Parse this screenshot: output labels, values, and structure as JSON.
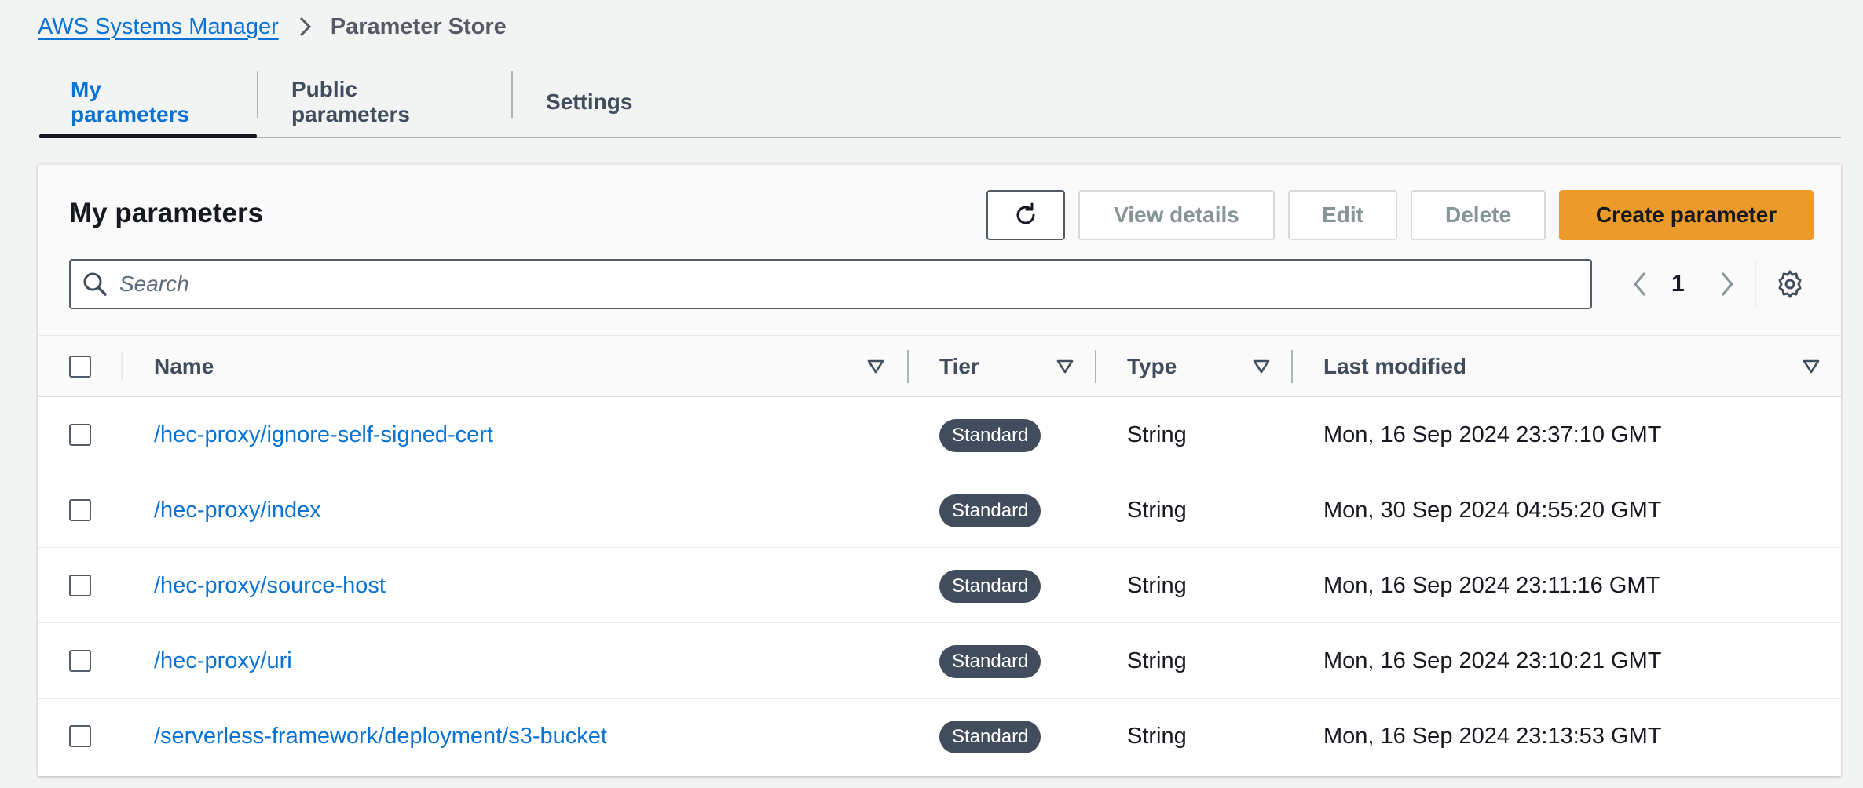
{
  "breadcrumb": {
    "parent": "AWS Systems Manager",
    "current": "Parameter Store"
  },
  "tabs": [
    {
      "label": "My parameters",
      "active": true
    },
    {
      "label": "Public parameters",
      "active": false
    },
    {
      "label": "Settings",
      "active": false
    }
  ],
  "panel": {
    "title": "My parameters",
    "buttons": {
      "view_details": "View details",
      "edit": "Edit",
      "delete": "Delete",
      "create": "Create parameter"
    },
    "search": {
      "placeholder": "Search",
      "value": ""
    },
    "pagination": {
      "current_page": "1"
    }
  },
  "table": {
    "columns": {
      "name": "Name",
      "tier": "Tier",
      "type": "Type",
      "last_modified": "Last modified"
    },
    "rows": [
      {
        "name": "/hec-proxy/ignore-self-signed-cert",
        "tier": "Standard",
        "type": "String",
        "last_modified": "Mon, 16 Sep 2024 23:37:10 GMT"
      },
      {
        "name": "/hec-proxy/index",
        "tier": "Standard",
        "type": "String",
        "last_modified": "Mon, 30 Sep 2024 04:55:20 GMT"
      },
      {
        "name": "/hec-proxy/source-host",
        "tier": "Standard",
        "type": "String",
        "last_modified": "Mon, 16 Sep 2024 23:11:16 GMT"
      },
      {
        "name": "/hec-proxy/uri",
        "tier": "Standard",
        "type": "String",
        "last_modified": "Mon, 16 Sep 2024 23:10:21 GMT"
      },
      {
        "name": "/serverless-framework/deployment/s3-bucket",
        "tier": "Standard",
        "type": "String",
        "last_modified": "Mon, 16 Sep 2024 23:13:53 GMT"
      }
    ]
  },
  "colors": {
    "link": "#0972d3",
    "primary_button": "#ec9b2b",
    "badge": "#414d5c",
    "background": "#f2f3f3"
  },
  "icons": {
    "breadcrumb_separator": "chevron-right-icon",
    "refresh": "refresh-icon",
    "search": "search-icon",
    "prev_page": "chevron-left-icon",
    "next_page": "chevron-right-icon",
    "preferences": "gear-icon",
    "sort": "sort-down-icon"
  }
}
